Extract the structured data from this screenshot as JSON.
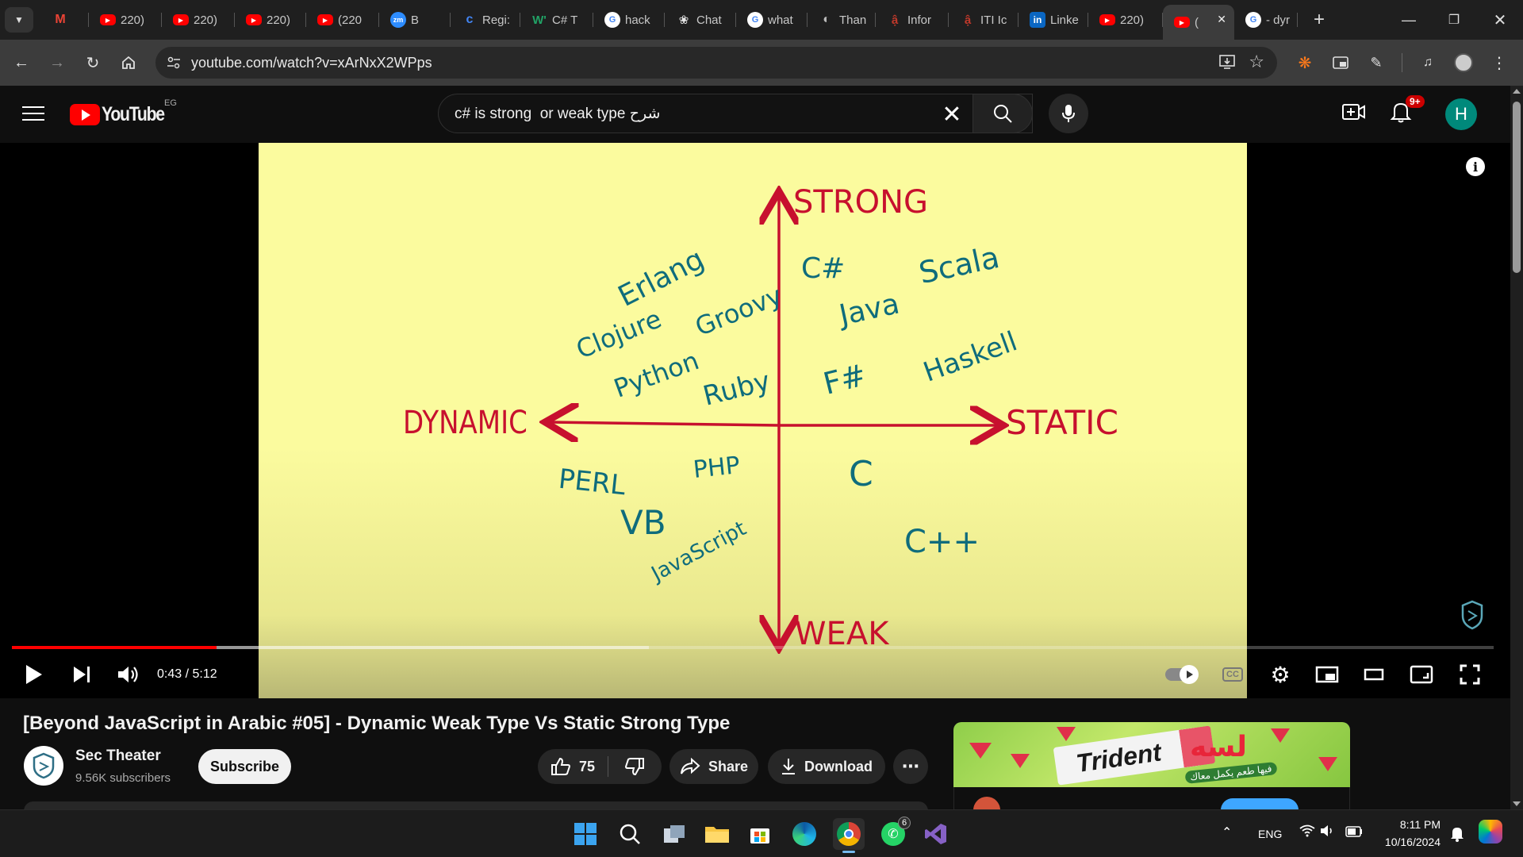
{
  "browser": {
    "tabs": [
      {
        "label": "",
        "icon": "gmail-icon"
      },
      {
        "label": "220)",
        "icon": "youtube-icon"
      },
      {
        "label": "220)",
        "icon": "youtube-icon"
      },
      {
        "label": "220)",
        "icon": "youtube-icon"
      },
      {
        "label": "(220",
        "icon": "youtube-icon"
      },
      {
        "label": "B",
        "icon": "zoom-icon"
      },
      {
        "label": "Regi:",
        "icon": "c-icon"
      },
      {
        "label": "C# T",
        "icon": "w-icon"
      },
      {
        "label": "hack",
        "icon": "google-icon"
      },
      {
        "label": "Chat",
        "icon": "chatgpt-icon"
      },
      {
        "label": "what",
        "icon": "google-icon"
      },
      {
        "label": "Than",
        "icon": "globe-icon"
      },
      {
        "label": "Infor",
        "icon": "iti-icon"
      },
      {
        "label": "ITI Ic",
        "icon": "iti-icon"
      },
      {
        "label": "Linke",
        "icon": "linkedin-icon"
      },
      {
        "label": "220)",
        "icon": "youtube-icon"
      },
      {
        "label": "(",
        "icon": "youtube-icon",
        "active": true
      },
      {
        "label": "- dyr",
        "icon": "google-icon"
      }
    ],
    "url": "youtube.com/watch?v=xArNxX2WPps"
  },
  "youtube": {
    "logo_text": "YouTube",
    "region": "EG",
    "search_query": "c# is strong  or weak type شرح",
    "notification_badge": "9+",
    "avatar_letter": "H"
  },
  "video": {
    "axis_labels": {
      "top": "STRONG",
      "bottom": "WEAK",
      "left": "DYNAMIC",
      "right": "STATIC"
    },
    "languages_top_left": [
      "Erlang",
      "Clojure",
      "Groovy",
      "Python",
      "Ruby"
    ],
    "languages_top_right": [
      "C#",
      "Scala",
      "Java",
      "Haskell",
      "F#"
    ],
    "languages_bottom_left": [
      "PERL",
      "PHP",
      "VB",
      "JavaScript"
    ],
    "languages_bottom_right": [
      "C",
      "C++"
    ],
    "time": "0:43 / 5:12",
    "progress_fraction": 0.138,
    "buffer_fraction": 0.43,
    "cc_label": "CC",
    "info_label": "i"
  },
  "details": {
    "title": "[Beyond JavaScript in Arabic #05] - Dynamic Weak Type Vs Static Strong Type",
    "channel_name": "Sec Theater",
    "subscribers": "9.56K subscribers",
    "subscribe_label": "Subscribe",
    "likes": "75",
    "share_label": "Share",
    "download_label": "Download",
    "more_label": "⋯"
  },
  "ad": {
    "brand": "Trident",
    "arabic_text": "لسه",
    "tagline": "فيها طعم يكمل معاك"
  },
  "taskbar": {
    "language": "ENG",
    "time": "8:11 PM",
    "date": "10/16/2024",
    "whatsapp_badge": "6"
  }
}
